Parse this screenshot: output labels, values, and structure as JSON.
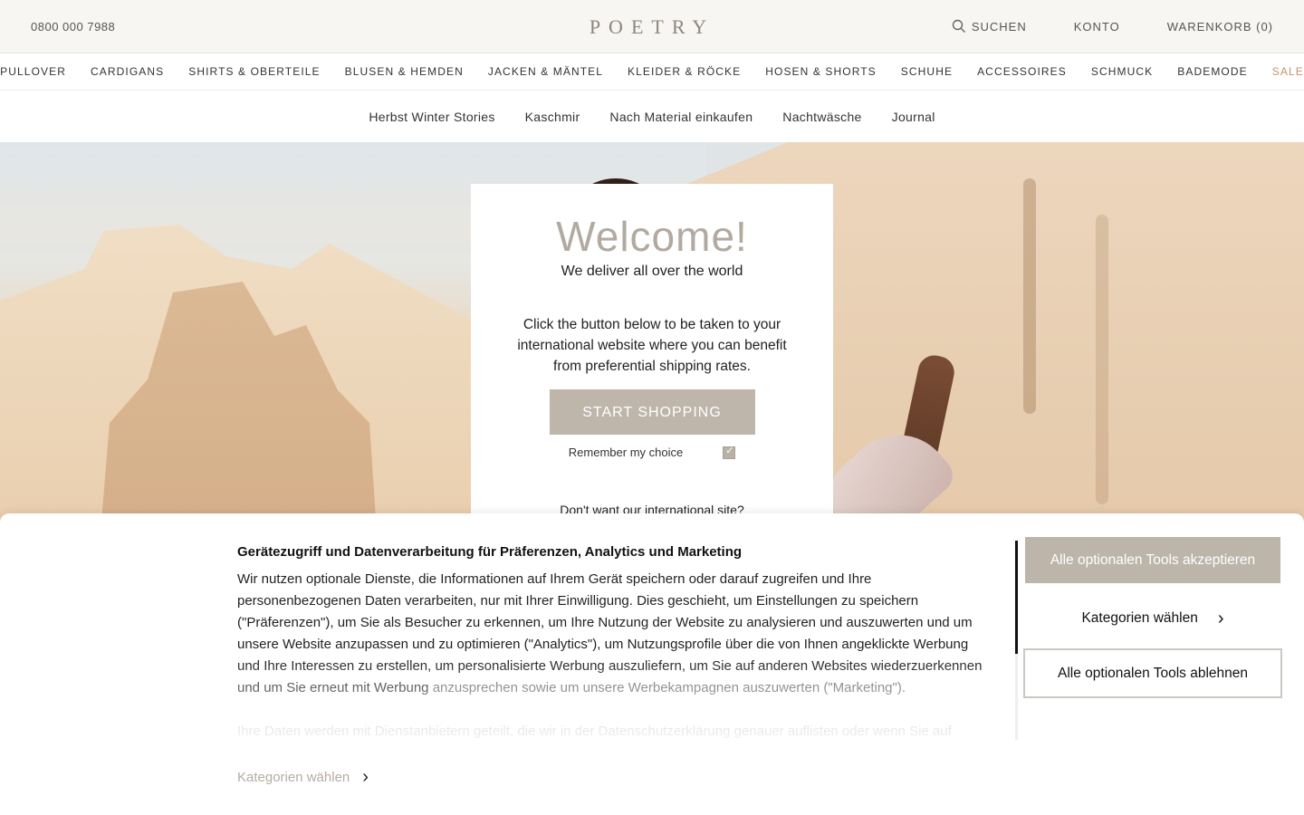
{
  "header": {
    "phone": "0800 000 7988",
    "logo": "POETRY",
    "search_label": "SUCHEN",
    "account_label": "KONTO",
    "cart_label": "WARENKORB (0)"
  },
  "nav_primary": [
    "PULLOVER",
    "CARDIGANS",
    "SHIRTS & OBERTEILE",
    "BLUSEN & HEMDEN",
    "JACKEN & MÄNTEL",
    "KLEIDER & RÖCKE",
    "HOSEN & SHORTS",
    "SCHUHE",
    "ACCESSOIRES",
    "SCHMUCK",
    "BADEMODE",
    "SALE"
  ],
  "nav_secondary": [
    "Herbst Winter Stories",
    "Kaschmir",
    "Nach Material einkaufen",
    "Nachtwäsche",
    "Journal"
  ],
  "modal": {
    "title": "Welcome!",
    "subtitle": "We deliver all over the world",
    "description": "Click the button below to be taken to your international website where you can benefit from preferential shipping rates.",
    "button": "START SHOPPING",
    "remember_label": "Remember my choice",
    "remember_checked": true,
    "decline_text": "Don't want our international site?"
  },
  "cookie": {
    "title": "Gerätezugriff und Datenverarbeitung für Präferenzen, Analytics und Marketing",
    "body_main": "Wir nutzen optionale Dienste, die Informationen auf Ihrem Gerät speichern oder darauf zugreifen und Ihre personenbezogenen Daten verarbeiten, nur mit Ihrer Einwilligung. Dies geschieht, um Einstellungen zu speichern (\"Präferenzen\"), um Sie als Besucher zu erkennen, um Ihre Nutzung der Website zu analysieren und auszuwerten und um unsere Website anzupassen und zu optimieren (\"Analytics\"), um Nutzungsprofile über die von Ihnen angeklickte Werbung und Ihre Interessen zu erstellen, um personalisierte Werbung auszuliefern, um Sie auf anderen Websites wiederzuerkennen und um Sie erneut mit Werbung",
    "body_faded": "anzusprechen sowie um unsere Werbekampagnen auszuwerten (\"Marketing\").",
    "body_more": "Ihre Daten werden mit Dienstanbietern geteilt, die wir in der Datenschutzerklärung genauer auflisten oder wenn Sie auf",
    "link_label": "Kategorien wählen",
    "accept_button": "Alle optionalen Tools akzeptieren",
    "categories_button": "Kategorien wählen",
    "decline_button": "Alle optionalen Tools ablehnen"
  },
  "colors": {
    "accent_beige": "#bdb5aa",
    "sale": "#c79264",
    "logo": "#8d877d"
  }
}
